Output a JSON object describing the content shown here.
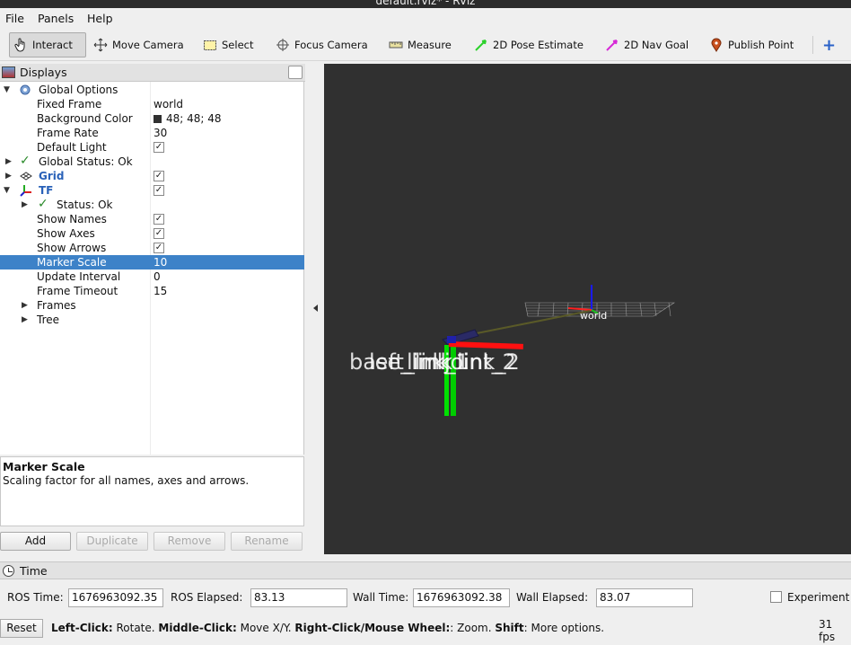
{
  "window": {
    "title": "default.rviz* - RViz"
  },
  "menu": {
    "file": "File",
    "panels": "Panels",
    "help": "Help"
  },
  "toolbar": {
    "interact": "Interact",
    "move_camera": "Move Camera",
    "select": "Select",
    "focus_camera": "Focus Camera",
    "measure": "Measure",
    "pose_estimate": "2D Pose Estimate",
    "nav_goal": "2D Nav Goal",
    "publish_point": "Publish Point",
    "add": "+"
  },
  "displays": {
    "title": "Displays",
    "global_options": "Global Options",
    "fixed_frame_label": "Fixed Frame",
    "fixed_frame_value": "world",
    "background_color_label": "Background Color",
    "background_color_value": "48; 48; 48",
    "background_color_hex": "#303030",
    "frame_rate_label": "Frame Rate",
    "frame_rate_value": "30",
    "default_light_label": "Default Light",
    "default_light_checked": true,
    "global_status": "Global Status: Ok",
    "grid": "Grid",
    "grid_checked": true,
    "tf": "TF",
    "tf_checked": true,
    "status": "Status: Ok",
    "show_names_label": "Show Names",
    "show_names_checked": true,
    "show_axes_label": "Show Axes",
    "show_axes_checked": true,
    "show_arrows_label": "Show Arrows",
    "show_arrows_checked": true,
    "marker_scale_label": "Marker Scale",
    "marker_scale_value": "10",
    "update_interval_label": "Update Interval",
    "update_interval_value": "0",
    "frame_timeout_label": "Frame Timeout",
    "frame_timeout_value": "15",
    "frames": "Frames",
    "tree": "Tree"
  },
  "description": {
    "title": "Marker Scale",
    "text": "Scaling factor for all names, axes and arrows."
  },
  "buttons": {
    "add": "Add",
    "duplicate": "Duplicate",
    "remove": "Remove",
    "rename": "Rename"
  },
  "viewport": {
    "world_label": "world",
    "overlapping_labels": [
      "base_link",
      "left_link",
      "link_1",
      "link_2",
      "joint_2"
    ]
  },
  "time": {
    "title": "Time",
    "ros_time_label": "ROS Time:",
    "ros_time_value": "1676963092.35",
    "ros_elapsed_label": "ROS Elapsed:",
    "ros_elapsed_value": "83.13",
    "wall_time_label": "Wall Time:",
    "wall_time_value": "1676963092.38",
    "wall_elapsed_label": "Wall Elapsed:",
    "wall_elapsed_value": "83.07",
    "experimental_label": "Experiment"
  },
  "status": {
    "reset": "Reset",
    "left_click": "Left-Click:",
    "left_click_desc": " Rotate. ",
    "middle_click": "Middle-Click:",
    "middle_click_desc": " Move X/Y. ",
    "right_click": "Right-Click/Mouse Wheel:",
    "right_click_desc": ": Zoom. ",
    "shift": "Shift",
    "shift_desc": ": More options.",
    "fps": "31 fps"
  },
  "colors": {
    "selection": "#3d82c8",
    "viewport_bg": "#303030",
    "axis_x": "#ff0000",
    "axis_y": "#00ff00",
    "axis_z": "#0000ff"
  }
}
